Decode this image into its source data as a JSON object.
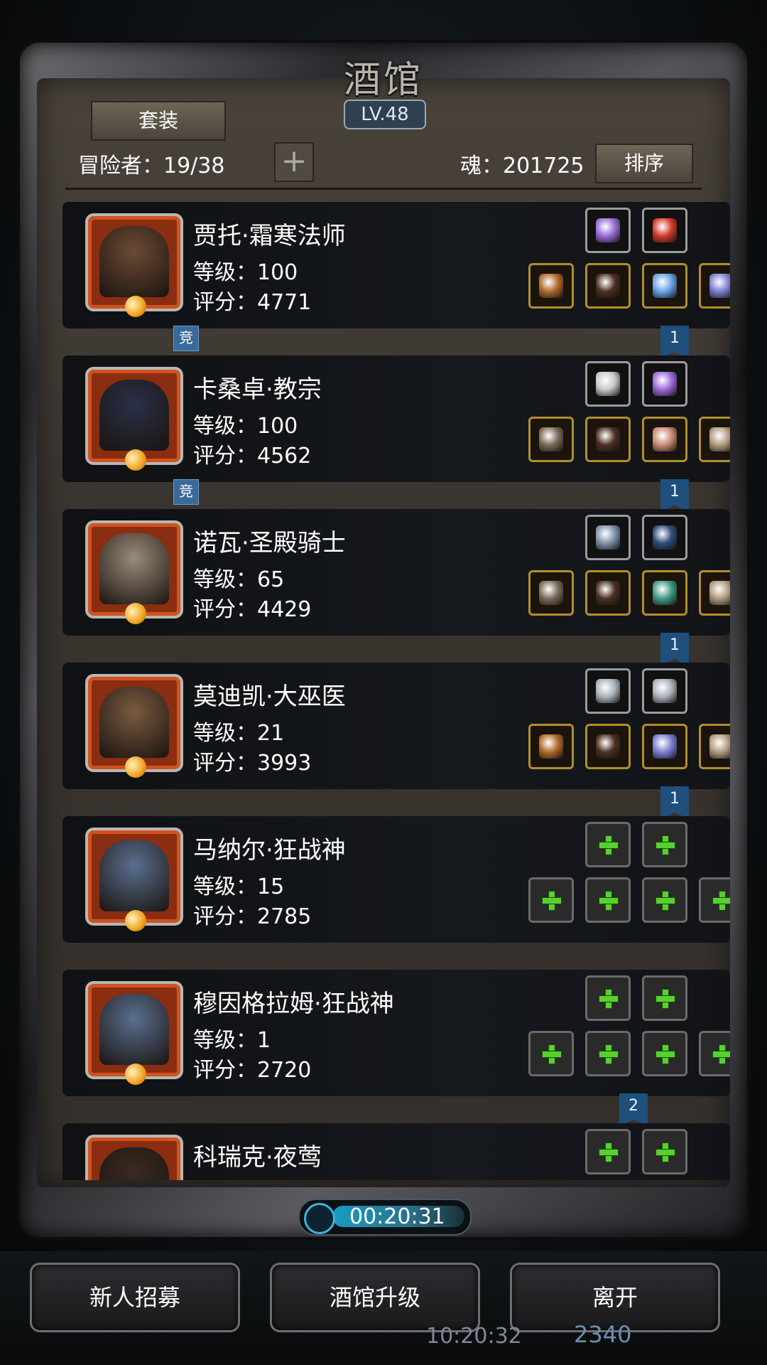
{
  "header": {
    "title": "酒馆",
    "level": "LV.48",
    "set_button": "套装",
    "adventurers_label": "冒险者：19/38",
    "soul_label": "魂：201725",
    "sort_button": "排序",
    "add_icon": "plus-icon"
  },
  "heroes": [
    {
      "name": "贾托·霜寒法师",
      "level": "等级：100",
      "score": "评分：4771",
      "portrait_color": "#6d4a34",
      "tag": "竞",
      "rank": "1",
      "top_slots": [
        {
          "icon": "purple-crystal-icon",
          "color": "#9c6bd6"
        },
        {
          "icon": "red-gem-icon",
          "color": "#d33a2a"
        }
      ],
      "bottom_slots": [
        {
          "icon": "staff-icon",
          "color": "#b06a2a"
        },
        {
          "icon": "robe-icon",
          "color": "#4a3020"
        },
        {
          "icon": "ring-icon",
          "color": "#6aa4e6"
        },
        {
          "icon": "heart-gem-icon",
          "color": "#7a7fd1"
        }
      ]
    },
    {
      "name": "卡桑卓·教宗",
      "level": "等级：100",
      "score": "评分：4562",
      "portrait_color": "#2a3048",
      "tag": "竞",
      "rank": "1",
      "top_slots": [
        {
          "icon": "stone-icon",
          "color": "#c8c8c8"
        },
        {
          "icon": "purple-crystal-icon",
          "color": "#9c6bd6"
        }
      ],
      "bottom_slots": [
        {
          "icon": "axe-icon",
          "color": "#7c6b58"
        },
        {
          "icon": "robe-icon",
          "color": "#4a3020"
        },
        {
          "icon": "amulet-icon",
          "color": "#c98a73"
        },
        {
          "icon": "gauntlet-icon",
          "color": "#b19a7c"
        }
      ]
    },
    {
      "name": "诺瓦·圣殿骑士",
      "level": "等级：65",
      "score": "评分：4429",
      "portrait_color": "#9b8c7a",
      "tag": "",
      "rank": "1",
      "top_slots": [
        {
          "icon": "tablet-icon",
          "color": "#7f93aa"
        },
        {
          "icon": "whip-icon",
          "color": "#2d4e7a"
        }
      ],
      "bottom_slots": [
        {
          "icon": "axe-icon",
          "color": "#7c6b58"
        },
        {
          "icon": "robe-icon",
          "color": "#4a3020"
        },
        {
          "icon": "bracelet-icon",
          "color": "#3f9a86"
        },
        {
          "icon": "gauntlet-icon",
          "color": "#b19a7c"
        }
      ]
    },
    {
      "name": "莫迪凯·大巫医",
      "level": "等级：21",
      "score": "评分：3993",
      "portrait_color": "#7a5a3f",
      "tag": "",
      "rank": "1",
      "top_slots": [
        {
          "icon": "dagger-icon",
          "color": "#aab3bc"
        },
        {
          "icon": "dagger-icon",
          "color": "#aab3bc"
        }
      ],
      "bottom_slots": [
        {
          "icon": "staff-icon",
          "color": "#b06a2a"
        },
        {
          "icon": "robe-icon",
          "color": "#4a3020"
        },
        {
          "icon": "heart-gem-icon",
          "color": "#7a7fd1"
        },
        {
          "icon": "gauntlet-icon",
          "color": "#b19a7c"
        }
      ]
    },
    {
      "name": "马纳尔·狂战神",
      "level": "等级：15",
      "score": "评分：2785",
      "portrait_color": "#5a6f8f",
      "tag": "",
      "rank": "",
      "top_slots": [
        {
          "icon": "plus-icon"
        },
        {
          "icon": "plus-icon"
        }
      ],
      "bottom_slots": [
        {
          "icon": "plus-icon"
        },
        {
          "icon": "plus-icon"
        },
        {
          "icon": "plus-icon"
        },
        {
          "icon": "plus-icon"
        }
      ]
    },
    {
      "name": "穆因格拉姆·狂战神",
      "level": "等级：1",
      "score": "评分：2720",
      "portrait_color": "#5a6f8f",
      "tag": "",
      "rank": "2",
      "top_slots": [
        {
          "icon": "plus-icon"
        },
        {
          "icon": "plus-icon"
        }
      ],
      "bottom_slots": [
        {
          "icon": "plus-icon"
        },
        {
          "icon": "plus-icon"
        },
        {
          "icon": "plus-icon"
        },
        {
          "icon": "plus-icon"
        }
      ]
    },
    {
      "name": "科瑞克·夜莺",
      "level": "",
      "score": "",
      "portrait_color": "#3a2a22",
      "tag": "",
      "rank": "",
      "top_slots": [
        {
          "icon": "plus-icon"
        },
        {
          "icon": "plus-icon"
        }
      ],
      "bottom_slots": []
    }
  ],
  "timer": {
    "value": "00:20:31",
    "icon": "clock-icon"
  },
  "bottom": {
    "recruit": "新人招募",
    "upgrade": "酒馆升级",
    "leave": "离开",
    "time": "10:20:32",
    "count": "2340"
  }
}
